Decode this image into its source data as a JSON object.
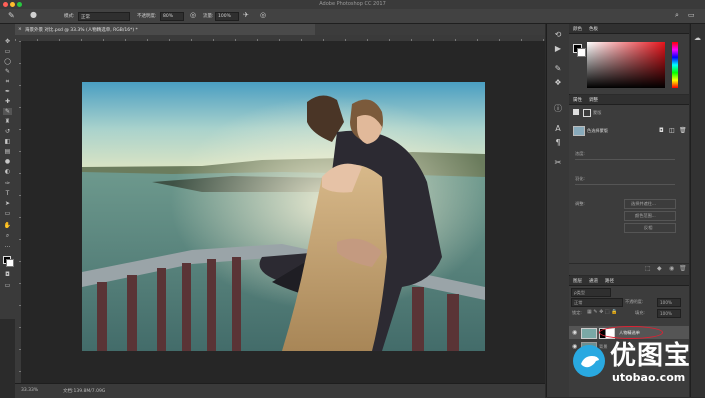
{
  "app": {
    "window_title": "Adobe Photoshop CC 2017"
  },
  "options_bar": {
    "mode_label": "模式:",
    "mode_value": "正常",
    "opacity_label": "不透明度:",
    "opacity_value": "80%",
    "flow_label": "流量:",
    "flow_value": "100%"
  },
  "document": {
    "tab_title": "海景外景 对比.psd @ 33.3% (人物精选单, RGB/16*) *"
  },
  "status": {
    "zoom": "33.33%",
    "doc_info": "文档:139.8M/7.09G"
  },
  "color_panel": {
    "tab1": "颜色",
    "tab2": "色板"
  },
  "properties_panel": {
    "tab1": "属性",
    "tab2": "调整",
    "subtitle": "蒙版",
    "layer_label": "色选择蒙版",
    "density_label": "浓度:",
    "feather_label": "羽化:",
    "refine_label": "调整:",
    "button1": "选择并遮住...",
    "button2": "颜色范围...",
    "button3": "反相"
  },
  "layers_panel": {
    "tab1": "图层",
    "tab2": "通道",
    "tab3": "路径",
    "filter_label": "ρ类型",
    "blend_mode": "正常",
    "opacity_label": "不透明度:",
    "opacity_value": "100%",
    "lock_label": "锁定:",
    "fill_label": "填充:",
    "fill_value": "100%",
    "layers": [
      {
        "name": "人物精选单",
        "selected": true
      },
      {
        "name": "背景",
        "selected": false
      }
    ]
  },
  "watermark": {
    "brand_cn": "优图宝",
    "brand_url": "utobao.com"
  },
  "colors": {
    "accent_red": "#c0392b",
    "window_bg": "#2b2b2b",
    "panel_bg": "#3c3c3c"
  },
  "icons": {
    "toolbar": [
      "move-icon",
      "marquee-icon",
      "lasso-icon",
      "quick-select-icon",
      "crop-icon",
      "eyedropper-icon",
      "healing-icon",
      "brush-icon",
      "stamp-icon",
      "history-brush-icon",
      "eraser-icon",
      "gradient-icon",
      "blur-icon",
      "dodge-icon",
      "pen-icon",
      "type-icon",
      "path-select-icon",
      "shape-icon",
      "hand-icon",
      "zoom-icon"
    ]
  }
}
